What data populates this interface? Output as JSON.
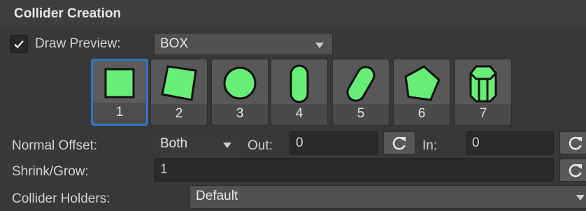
{
  "section": {
    "title": "Collider Creation"
  },
  "draw_preview": {
    "checked": true,
    "label": "Draw Preview:",
    "selected": "BOX"
  },
  "shapes": [
    {
      "number": "1",
      "icon": "square-shape-icon",
      "selected": true
    },
    {
      "number": "2",
      "icon": "rotated-square-shape-icon",
      "selected": false
    },
    {
      "number": "3",
      "icon": "circle-shape-icon",
      "selected": false
    },
    {
      "number": "4",
      "icon": "capsule-shape-icon",
      "selected": false
    },
    {
      "number": "5",
      "icon": "tilted-capsule-shape-icon",
      "selected": false
    },
    {
      "number": "6",
      "icon": "pentagon-shape-icon",
      "selected": false
    },
    {
      "number": "7",
      "icon": "cylinder-shape-icon",
      "selected": false
    }
  ],
  "normal_offset": {
    "label": "Normal Offset:",
    "mode": "Both",
    "out_label": "Out:",
    "out_value": "0",
    "in_label": "In:",
    "in_value": "0"
  },
  "shrink_grow": {
    "label": "Shrink/Grow:",
    "value": "1"
  },
  "collider_holders": {
    "label": "Collider Holders:",
    "selected": "Default"
  },
  "colors": {
    "accent": "#2f74c8",
    "shape_fill": "#66ee77",
    "background": "#383838"
  }
}
